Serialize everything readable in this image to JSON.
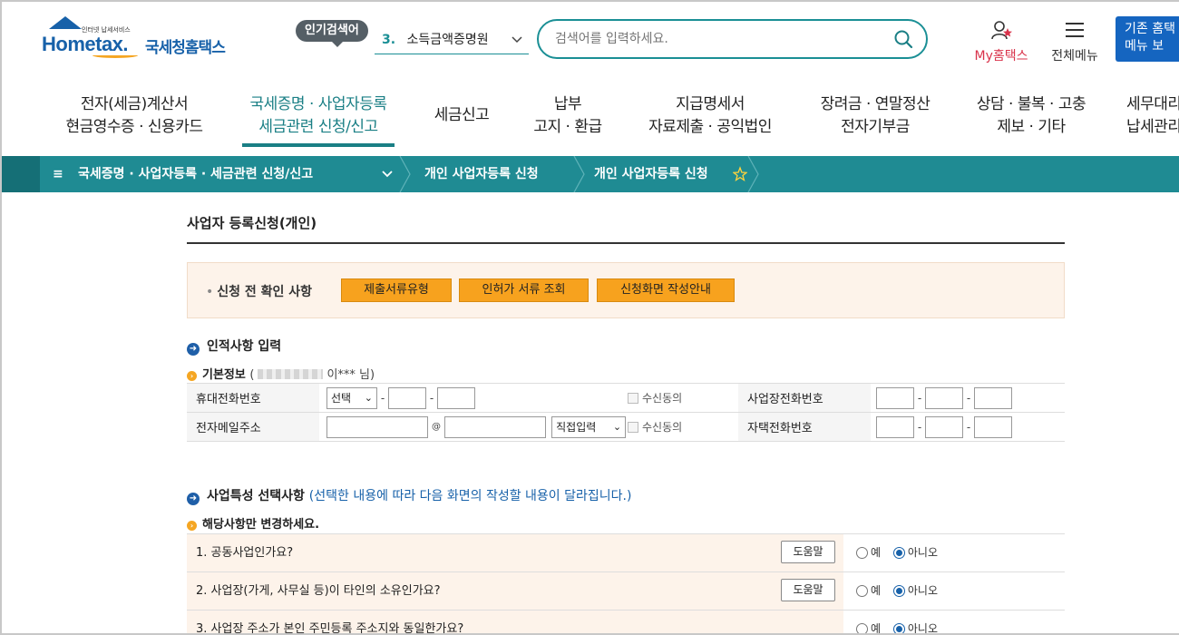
{
  "header": {
    "logo_sub": "인터넷 납세서비스",
    "logo_main": "Hometax.",
    "logo_kr": "국세청홈택스",
    "popular_badge": "인기검색어",
    "popular_num": "3.",
    "popular_term": "소득금액증명원",
    "search_placeholder": "검색어를 입력하세요.",
    "my_hometax": "My홈택스",
    "all_menu": "전체메뉴",
    "legacy_line1": "기존 홈택",
    "legacy_line2": "메뉴 보"
  },
  "gnb": [
    {
      "line1": "전자(세금)계산서",
      "line2": "현금영수증 · 신용카드"
    },
    {
      "line1": "국세증명 · 사업자등록",
      "line2": "세금관련 신청/신고"
    },
    {
      "line1": "세금신고",
      "line2": ""
    },
    {
      "line1": "납부",
      "line2": "고지 · 환급"
    },
    {
      "line1": "지급명세서",
      "line2": "자료제출 · 공익법인"
    },
    {
      "line1": "장려금 · 연말정산",
      "line2": "전자기부금"
    },
    {
      "line1": "상담 · 불복 · 고충",
      "line2": "제보 · 기타"
    },
    {
      "line1": "세무대리",
      "line2": "납세관리"
    }
  ],
  "breadcrumb": {
    "menu_icon": "≡",
    "level1": "국세증명 · 사업자등록 · 세금관련 신청/신고",
    "level2": "개인 사업자등록 신청",
    "level3": "개인 사업자등록 신청"
  },
  "page": {
    "title": "사업자 등록신청(개인)",
    "confirm_label": "신청 전 확인 사항",
    "btn_docs": "제출서류유형",
    "btn_permit": "인허가 서류 조회",
    "btn_guide": "신청화면 작성안내"
  },
  "identity": {
    "heading": "인적사항 입력",
    "basic_info": "기본정보",
    "user_paren_open": "(",
    "user_name": "이*** 님)",
    "rows": [
      {
        "label": "휴대전화번호",
        "select": "선택",
        "consent": "수신동의",
        "label2": "사업장전화번호"
      },
      {
        "label": "전자메일주소",
        "at": "@",
        "select": "직접입력",
        "consent": "수신동의",
        "label2": "자택전화번호"
      }
    ]
  },
  "business": {
    "heading": "사업특성 선택사항",
    "note": "(선택한 내용에 따라 다음 화면의 작성할 내용이 달라집니다.)",
    "subheading": "해당사항만 변경하세요.",
    "help_label": "도움말",
    "yes": "예",
    "no": "아니오",
    "questions": [
      "1. 공동사업인가요?",
      "2. 사업장(가게, 사무실 등)이 타인의 소유인가요?",
      "3. 사업장 주소가 본인 주민등록 주소지와 동일한가요?"
    ]
  },
  "colors": {
    "teal": "#1f8b93",
    "brand_blue": "#1761a9",
    "orange_btn": "#f7a21e",
    "accent_red": "#d9334b"
  }
}
